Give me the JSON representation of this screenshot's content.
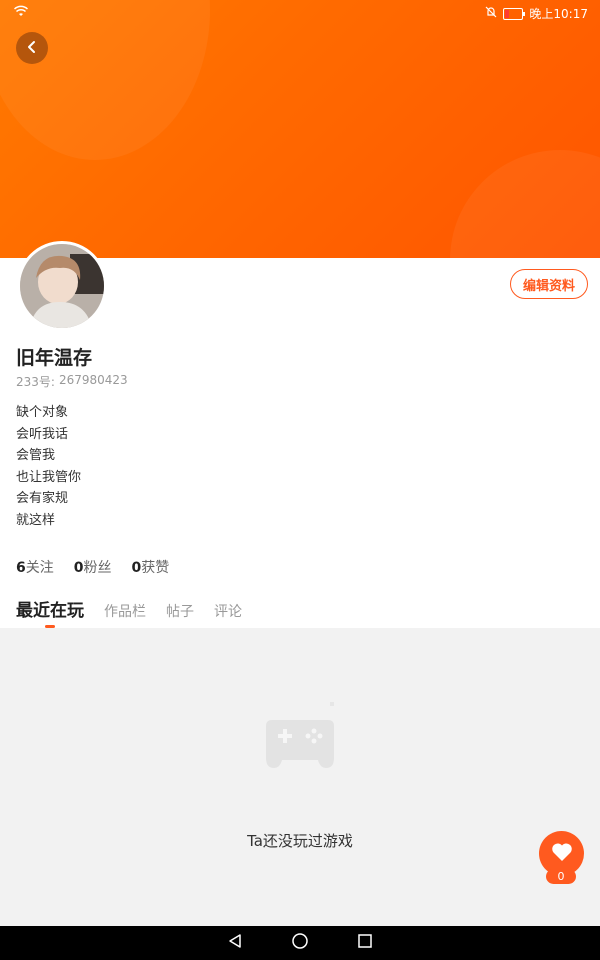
{
  "status": {
    "time": "晚上10:17"
  },
  "header": {
    "edit_label": "编辑资料"
  },
  "profile": {
    "name": "旧年温存",
    "uid_label": "233号:",
    "uid_value": "267980423",
    "bio": [
      "缺个对象",
      "会听我话",
      "会管我",
      "也让我管你",
      "会有家规",
      "就这样"
    ]
  },
  "stats": [
    {
      "value": "6",
      "label": "关注"
    },
    {
      "value": "0",
      "label": "粉丝"
    },
    {
      "value": "0",
      "label": "获赞"
    }
  ],
  "tabs": [
    {
      "label": "最近在玩",
      "active": true
    },
    {
      "label": "作品栏",
      "active": false
    },
    {
      "label": "帖子",
      "active": false
    },
    {
      "label": "评论",
      "active": false
    }
  ],
  "empty": {
    "text": "Ta还没玩过游戏"
  },
  "like": {
    "count": "0"
  },
  "icons": [
    "wifi-icon",
    "mute-bell-icon",
    "battery-icon",
    "back-arrow-icon",
    "gamepad-icon",
    "heart-icon",
    "nav-back-icon",
    "nav-home-icon",
    "nav-recents-icon"
  ],
  "colors": {
    "accent": "#ff5a1f",
    "banner": "#ff6a00"
  }
}
